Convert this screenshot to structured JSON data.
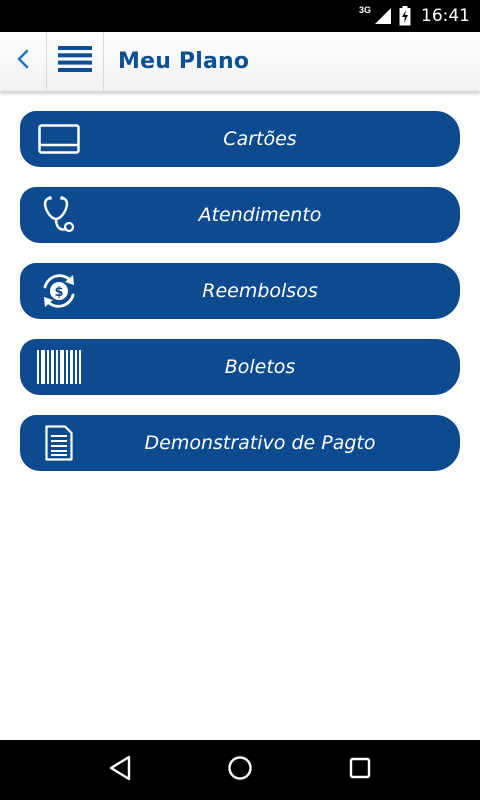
{
  "status_bar": {
    "network": "3G",
    "time": "16:41"
  },
  "header": {
    "title": "Meu Plano"
  },
  "menu": {
    "items": [
      {
        "label": "Cartões",
        "icon": "card-icon"
      },
      {
        "label": "Atendimento",
        "icon": "stethoscope-icon"
      },
      {
        "label": "Reembolsos",
        "icon": "refund-icon"
      },
      {
        "label": "Boletos",
        "icon": "barcode-icon"
      },
      {
        "label": "Demonstrativo de Pagto",
        "icon": "document-icon"
      }
    ]
  },
  "colors": {
    "brand_blue": "#0d4a8f",
    "title_blue": "#0d4f94",
    "status_bar": "#000000"
  }
}
